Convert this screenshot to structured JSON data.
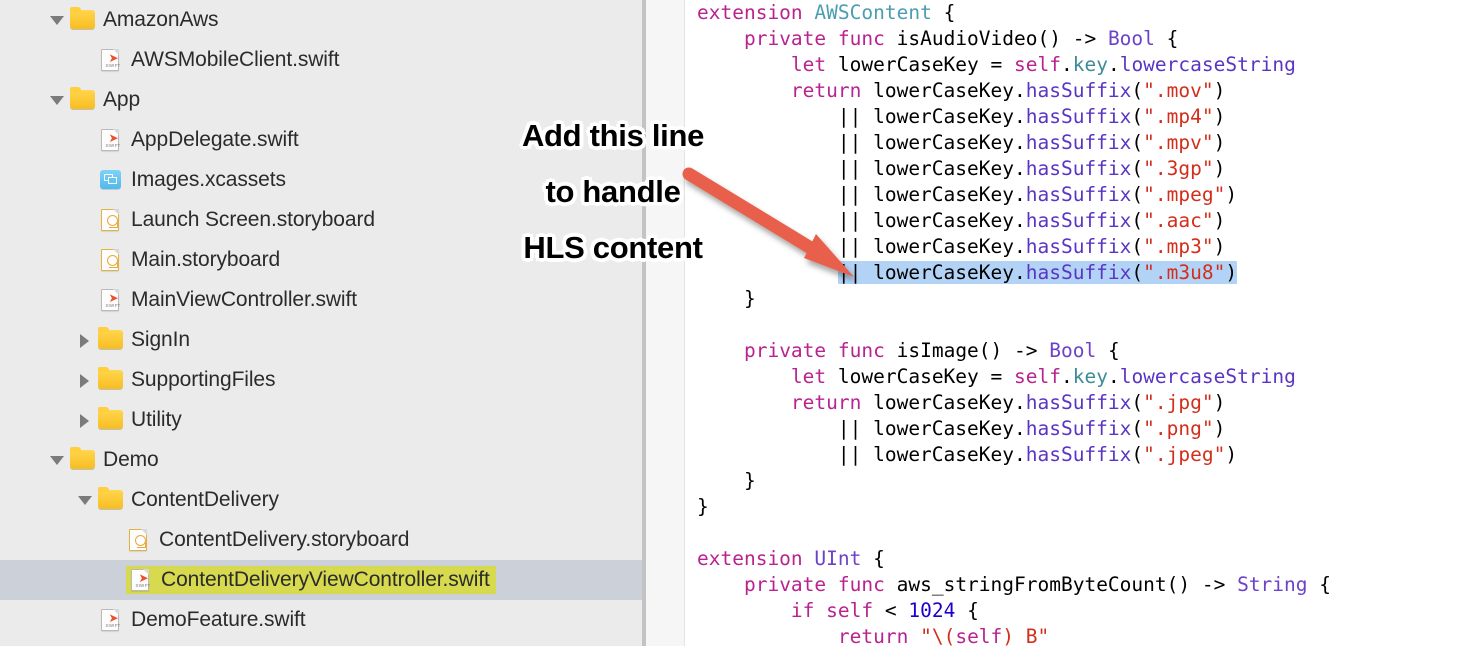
{
  "colors": {
    "sidebar_bg": "#ebebeb",
    "selected_row_bg": "#ccd0d8",
    "file_highlight_bg": "#d7da4f",
    "code_selection_bg": "#b3d3f6",
    "arrow": "#e8604c",
    "keyword": "#b8238f",
    "string": "#d12f1b",
    "method": "#5a35c4",
    "type": "#4b9daf",
    "number": "#1c00cf"
  },
  "navigator": {
    "items": [
      {
        "label": "AmazonAws",
        "icon": "folder-icon",
        "disclosure": "open",
        "indent": 0,
        "selected": false,
        "highlighted": false
      },
      {
        "label": "AWSMobileClient.swift",
        "icon": "swift-file-icon",
        "disclosure": "none",
        "indent": 1,
        "selected": false,
        "highlighted": false
      },
      {
        "label": "App",
        "icon": "folder-icon",
        "disclosure": "open",
        "indent": 0,
        "selected": false,
        "highlighted": false
      },
      {
        "label": "AppDelegate.swift",
        "icon": "swift-file-icon",
        "disclosure": "none",
        "indent": 1,
        "selected": false,
        "highlighted": false
      },
      {
        "label": "Images.xcassets",
        "icon": "asset-catalog-icon",
        "disclosure": "none",
        "indent": 1,
        "selected": false,
        "highlighted": false
      },
      {
        "label": "Launch Screen.storyboard",
        "icon": "storyboard-file-icon",
        "disclosure": "none",
        "indent": 1,
        "selected": false,
        "highlighted": false
      },
      {
        "label": "Main.storyboard",
        "icon": "storyboard-file-icon",
        "disclosure": "none",
        "indent": 1,
        "selected": false,
        "highlighted": false
      },
      {
        "label": "MainViewController.swift",
        "icon": "swift-file-icon",
        "disclosure": "none",
        "indent": 1,
        "selected": false,
        "highlighted": false
      },
      {
        "label": "SignIn",
        "icon": "folder-icon",
        "disclosure": "closed",
        "indent": 1,
        "selected": false,
        "highlighted": false
      },
      {
        "label": "SupportingFiles",
        "icon": "folder-icon",
        "disclosure": "closed",
        "indent": 1,
        "selected": false,
        "highlighted": false
      },
      {
        "label": "Utility",
        "icon": "folder-icon",
        "disclosure": "closed",
        "indent": 1,
        "selected": false,
        "highlighted": false
      },
      {
        "label": "Demo",
        "icon": "folder-icon",
        "disclosure": "open",
        "indent": 0,
        "selected": false,
        "highlighted": false
      },
      {
        "label": "ContentDelivery",
        "icon": "folder-icon",
        "disclosure": "open",
        "indent": 1,
        "selected": false,
        "highlighted": false
      },
      {
        "label": "ContentDelivery.storyboard",
        "icon": "storyboard-file-icon",
        "disclosure": "none",
        "indent": 2,
        "selected": false,
        "highlighted": false
      },
      {
        "label": "ContentDeliveryViewController.swift",
        "icon": "swift-file-icon",
        "disclosure": "none",
        "indent": 2,
        "selected": true,
        "highlighted": true
      },
      {
        "label": "DemoFeature.swift",
        "icon": "swift-file-icon",
        "disclosure": "none",
        "indent": 1,
        "selected": false,
        "highlighted": false
      }
    ]
  },
  "annotation": {
    "lines": [
      "Add this line",
      "to handle",
      "HLS content"
    ],
    "arrow_name": "pointer-arrow"
  },
  "editor": {
    "language": "swift",
    "selected_line_index": 9,
    "lines": [
      {
        "text": "extension AWSContent {",
        "selected": false
      },
      {
        "text": "    private func isAudioVideo() -> Bool {",
        "selected": false
      },
      {
        "text": "        let lowerCaseKey = self.key.lowercaseString",
        "selected": false
      },
      {
        "text": "        return lowerCaseKey.hasSuffix(\".mov\")",
        "selected": false
      },
      {
        "text": "            || lowerCaseKey.hasSuffix(\".mp4\")",
        "selected": false
      },
      {
        "text": "            || lowerCaseKey.hasSuffix(\".mpv\")",
        "selected": false
      },
      {
        "text": "            || lowerCaseKey.hasSuffix(\".3gp\")",
        "selected": false
      },
      {
        "text": "            || lowerCaseKey.hasSuffix(\".mpeg\")",
        "selected": false
      },
      {
        "text": "            || lowerCaseKey.hasSuffix(\".aac\")",
        "selected": false
      },
      {
        "text": "            || lowerCaseKey.hasSuffix(\".mp3\")",
        "selected": false
      },
      {
        "text": "            || lowerCaseKey.hasSuffix(\".m3u8\")",
        "selected": true
      },
      {
        "text": "    }",
        "selected": false
      },
      {
        "text": "",
        "selected": false
      },
      {
        "text": "    private func isImage() -> Bool {",
        "selected": false
      },
      {
        "text": "        let lowerCaseKey = self.key.lowercaseString",
        "selected": false
      },
      {
        "text": "        return lowerCaseKey.hasSuffix(\".jpg\")",
        "selected": false
      },
      {
        "text": "            || lowerCaseKey.hasSuffix(\".png\")",
        "selected": false
      },
      {
        "text": "            || lowerCaseKey.hasSuffix(\".jpeg\")",
        "selected": false
      },
      {
        "text": "    }",
        "selected": false
      },
      {
        "text": "}",
        "selected": false
      },
      {
        "text": "",
        "selected": false
      },
      {
        "text": "extension UInt {",
        "selected": false
      },
      {
        "text": "    private func aws_stringFromByteCount() -> String {",
        "selected": false
      },
      {
        "text": "        if self < 1024 {",
        "selected": false
      },
      {
        "text": "            return \"\\(self) B\"",
        "selected": false
      }
    ]
  }
}
